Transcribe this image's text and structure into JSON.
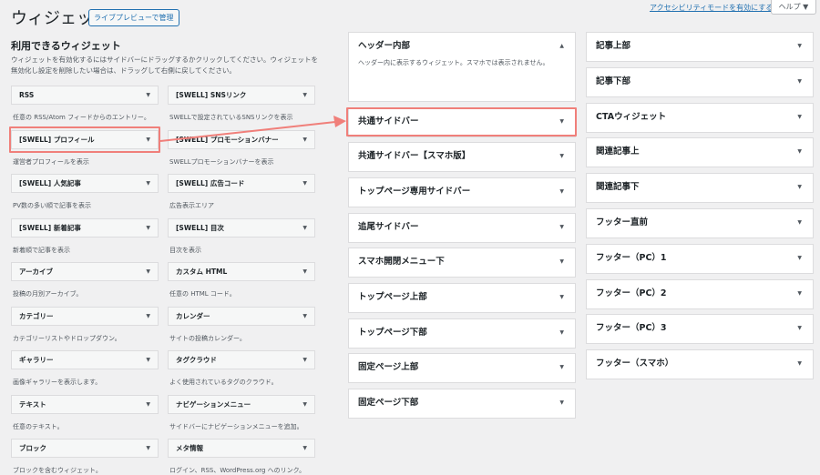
{
  "header": {
    "title": "ウィジェット",
    "preview_button": "ライブプレビューで管理",
    "accessibility_link": "アクセシビリティモードを有効にする",
    "help_tab": "ヘルプ ▼"
  },
  "available": {
    "heading": "利用できるウィジェット",
    "description": "ウィジェットを有効化するにはサイドバーにドラッグするかクリックしてください。ウィジェットを無効化し設定を削除したい場合は、ドラッグして右側に戻してください。",
    "widgets": [
      {
        "name": "RSS",
        "desc": "任意の RSS/Atom フィードからのエントリー。"
      },
      {
        "name": "[SWELL] SNSリンク",
        "desc": "SWELLで設定されているSNSリンクを表示"
      },
      {
        "name": "[SWELL] プロフィール",
        "desc": "運営者プロフィールを表示"
      },
      {
        "name": "[SWELL] プロモーションバナー",
        "desc": "SWELLプロモーションバナーを表示"
      },
      {
        "name": "[SWELL] 人気記事",
        "desc": "PV数の多い順で記事を表示"
      },
      {
        "name": "[SWELL] 広告コード",
        "desc": "広告表示エリア"
      },
      {
        "name": "[SWELL] 新着記事",
        "desc": "新着順で記事を表示"
      },
      {
        "name": "[SWELL] 目次",
        "desc": "目次を表示"
      },
      {
        "name": "アーカイブ",
        "desc": "投稿の月別アーカイブ。"
      },
      {
        "name": "カスタム HTML",
        "desc": "任意の HTML コード。"
      },
      {
        "name": "カテゴリー",
        "desc": "カテゴリーリストやドロップダウン。"
      },
      {
        "name": "カレンダー",
        "desc": "サイトの投稿カレンダー。"
      },
      {
        "name": "ギャラリー",
        "desc": "画像ギャラリーを表示します。"
      },
      {
        "name": "タグクラウド",
        "desc": "よく使用されているタグのクラウド。"
      },
      {
        "name": "テキスト",
        "desc": "任意のテキスト。"
      },
      {
        "name": "ナビゲーションメニュー",
        "desc": "サイドバーにナビゲーションメニューを追加。"
      },
      {
        "name": "ブロック",
        "desc": "ブロックを含むウィジェット。"
      },
      {
        "name": "メタ情報",
        "desc": "ログイン、RSS、WordPress.org へのリンク。"
      }
    ]
  },
  "sidebars_mid": [
    {
      "title": "ヘッダー内部",
      "desc": "ヘッダー内に表示するウィジェット。スマホでは表示されません。",
      "open": true
    },
    {
      "title": "共通サイドバー"
    },
    {
      "title": "共通サイドバー【スマホ版】"
    },
    {
      "title": "トップページ専用サイドバー"
    },
    {
      "title": "追尾サイドバー"
    },
    {
      "title": "スマホ開閉メニュー下"
    },
    {
      "title": "トップページ上部"
    },
    {
      "title": "トップページ下部"
    },
    {
      "title": "固定ページ上部"
    },
    {
      "title": "固定ページ下部"
    }
  ],
  "sidebars_right": [
    {
      "title": "記事上部"
    },
    {
      "title": "記事下部"
    },
    {
      "title": "CTAウィジェット"
    },
    {
      "title": "関連記事上"
    },
    {
      "title": "関連記事下"
    },
    {
      "title": "フッター直前"
    },
    {
      "title": "フッター（PC）1"
    },
    {
      "title": "フッター（PC）2"
    },
    {
      "title": "フッター（PC）3"
    },
    {
      "title": "フッター（スマホ）"
    }
  ],
  "icons": {
    "toggle_collapsed": "▼",
    "toggle_open": "▲"
  },
  "colors": {
    "highlight": "#f07f7a",
    "link": "#2271b1",
    "background": "#f0f0f1"
  }
}
